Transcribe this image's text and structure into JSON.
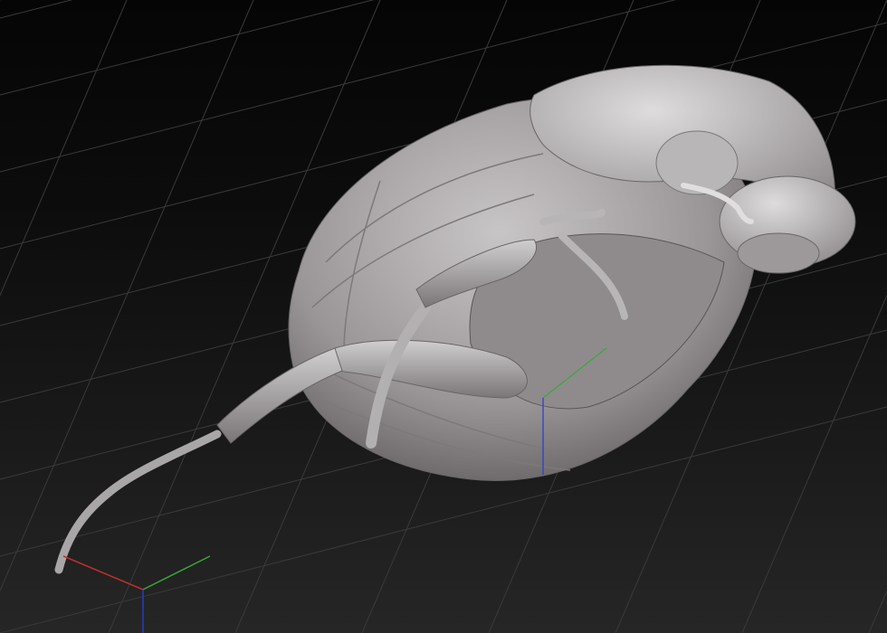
{
  "viewport": {
    "background_top": "#050505",
    "background_bottom": "#262626",
    "grid_color": "#3a3a3a",
    "model_color": "#a8a5a6",
    "model_shadow": "#5e5a5b",
    "model_highlight": "#d4d2d3"
  },
  "gizmo": {
    "x_axis_color": "#c0302a",
    "y_axis_color": "#3aa83a",
    "z_axis_color": "#2a3ac8"
  }
}
